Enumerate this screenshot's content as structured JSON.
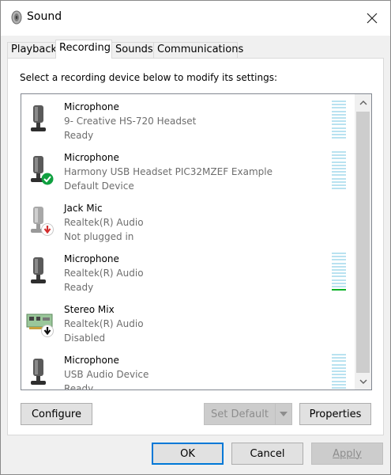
{
  "window": {
    "title": "Sound"
  },
  "tabs": [
    {
      "label": "Playback",
      "active": false
    },
    {
      "label": "Recording",
      "active": true
    },
    {
      "label": "Sounds",
      "active": false
    },
    {
      "label": "Communications",
      "active": false
    }
  ],
  "instruction": "Select a recording device below to modify its settings:",
  "devices": [
    {
      "name": "Microphone",
      "description": "9- Creative HS-720 Headset",
      "status": "Ready",
      "icon": "microphone-icon",
      "badge": null,
      "level": 0
    },
    {
      "name": "Microphone",
      "description": "Harmony USB Headset PIC32MZEF Example",
      "status": "Default Device",
      "icon": "microphone-icon",
      "badge": "default-checkmark-icon",
      "level": 0
    },
    {
      "name": "Jack Mic",
      "description": "Realtek(R) Audio",
      "status": "Not plugged in",
      "icon": "microphone-icon",
      "badge": "unplugged-arrow-icon",
      "level": null
    },
    {
      "name": "Microphone",
      "description": "Realtek(R) Audio",
      "status": "Ready",
      "icon": "microphone-icon",
      "badge": null,
      "level": 0.05
    },
    {
      "name": "Stereo Mix",
      "description": "Realtek(R) Audio",
      "status": "Disabled",
      "icon": "sound-card-icon",
      "badge": "disabled-arrow-icon",
      "level": null
    },
    {
      "name": "Microphone",
      "description": "USB Audio Device",
      "status": "Ready",
      "icon": "microphone-icon",
      "badge": null,
      "level": 0
    }
  ],
  "buttons": {
    "configure": "Configure",
    "set_default": "Set Default",
    "properties": "Properties",
    "ok": "OK",
    "cancel": "Cancel",
    "apply": "Apply"
  },
  "colors": {
    "meter_empty": "#b9e2f0",
    "meter_active": "#06b025",
    "default_badge": "#10a040",
    "unplugged_badge": "#d32f2f",
    "focus_border": "#0078d7"
  }
}
